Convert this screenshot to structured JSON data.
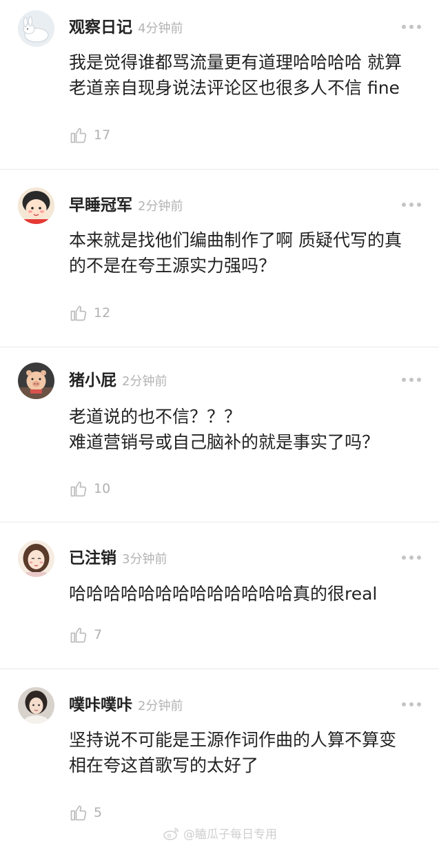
{
  "comments": [
    {
      "username": "观察日记",
      "time": "4分钟前",
      "text": "我是觉得谁都骂流量更有道理哈哈哈哈 就算\n老道亲自现身说法评论区也很多人不信 fine",
      "likes": "17",
      "avatar_icon": "white-rabbit-icon"
    },
    {
      "username": "早睡冠军",
      "time": "2分钟前",
      "text": "本来就是找他们编曲制作了啊 质疑代写的真\n的不是在夸王源实力强吗？",
      "likes": "12",
      "avatar_icon": "cartoon-girl-icon"
    },
    {
      "username": "猪小屁",
      "time": "2分钟前",
      "text": "老道说的也不信？？？\n难道营销号或自己脑补的就是事实了吗？",
      "likes": "10",
      "avatar_icon": "pig-doll-icon"
    },
    {
      "username": "已注销",
      "time": "3分钟前",
      "text": "哈哈哈哈哈哈哈哈哈哈哈哈哈真的很real",
      "likes": "7",
      "avatar_icon": "drawn-girl-icon"
    },
    {
      "username": "噗咔噗咔",
      "time": "2分钟前",
      "text": "坚持说不可能是王源作词作曲的人算不算变\n相在夸这首歌写的太好了",
      "likes": "5",
      "avatar_icon": "photo-person-icon"
    }
  ],
  "watermark": {
    "text": "@瞌瓜子每日专用",
    "icon": "weibo-logo-icon"
  },
  "colors": {
    "username": "#222222",
    "time": "#b3b3b3",
    "like_count": "#b0b0b0",
    "divider": "#e8e8e8"
  }
}
